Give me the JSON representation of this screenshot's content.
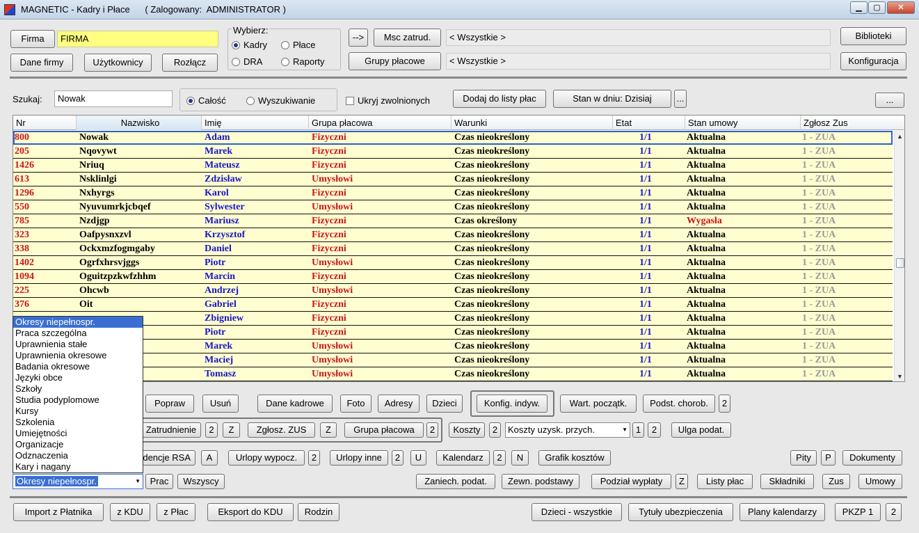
{
  "window": {
    "title": "MAGNETIC - Kadry i Płace      ( Zalogowany:  ADMINISTRATOR )",
    "minimize": "▁",
    "maximize": "▢",
    "close": "✕"
  },
  "top": {
    "firma_button": "Firma",
    "firma_value": "FIRMA",
    "dane_firmy": "Dane firmy",
    "uzytkownicy": "Użytkownicy",
    "rozlacz": "Rozłącz",
    "wybierz_label": "Wybierz:",
    "radio_kadry": "Kadry",
    "radio_place": "Płace",
    "radio_dra": "DRA",
    "radio_raporty": "Raporty",
    "arrow_button": "-->",
    "msc_zatrud": "Msc zatrud.",
    "msc_value": "< Wszystkie >",
    "grupy_placowe": "Grupy płacowe",
    "grupy_value": "< Wszystkie >",
    "biblioteki": "Biblioteki",
    "konfiguracja": "Konfiguracja"
  },
  "search": {
    "label": "Szukaj:",
    "value": "Nowak",
    "radio_calosc": "Całość",
    "radio_wyszukiwanie": "Wyszukiwanie",
    "ukryj": "Ukryj zwolnionych",
    "dodaj": "Dodaj do listy płac",
    "stan_w_dniu": "Stan w dniu: Dzisiaj",
    "dots": "...",
    "dots2": "..."
  },
  "table": {
    "columns": [
      "Nr",
      "Nazwisko",
      "Imię",
      "Grupa płacowa",
      "Warunki",
      "Etat",
      "Stan umowy",
      "Zgłosz Zus"
    ],
    "rows": [
      {
        "nr": "800",
        "nazwisko": "Nowak",
        "imie": "Adam",
        "grupa": "Fizyczni",
        "warunki": "Czas nieokreślony",
        "etat": "1/1",
        "stan": "Aktualna",
        "zus": "1 - ZUA"
      },
      {
        "nr": "205",
        "nazwisko": "Nqovywt",
        "imie": "Marek",
        "grupa": "Fizyczni",
        "warunki": "Czas nieokreślony",
        "etat": "1/1",
        "stan": "Aktualna",
        "zus": "1 - ZUA"
      },
      {
        "nr": "1426",
        "nazwisko": "Nriuq",
        "imie": "Mateusz",
        "grupa": "Fizyczni",
        "warunki": "Czas nieokreślony",
        "etat": "1/1",
        "stan": "Aktualna",
        "zus": "1 - ZUA"
      },
      {
        "nr": "613",
        "nazwisko": "Nsklinlgi",
        "imie": "Zdzisław",
        "grupa": "Umysłowi",
        "warunki": "Czas nieokreślony",
        "etat": "1/1",
        "stan": "Aktualna",
        "zus": "1 - ZUA"
      },
      {
        "nr": "1296",
        "nazwisko": "Nxhyrgs",
        "imie": "Karol",
        "grupa": "Fizyczni",
        "warunki": "Czas nieokreślony",
        "etat": "1/1",
        "stan": "Aktualna",
        "zus": "1 - ZUA"
      },
      {
        "nr": "550",
        "nazwisko": "Nyuvumrkjcbqef",
        "imie": "Sylwester",
        "grupa": "Umysłowi",
        "warunki": "Czas nieokreślony",
        "etat": "1/1",
        "stan": "Aktualna",
        "zus": "1 - ZUA"
      },
      {
        "nr": "785",
        "nazwisko": "Nzdjgp",
        "imie": "Mariusz",
        "grupa": "Fizyczni",
        "warunki": "Czas określony",
        "etat": "1/1",
        "stan": "Wygasła",
        "zus": "1 - ZUA"
      },
      {
        "nr": "323",
        "nazwisko": "Oafpysnxzvl",
        "imie": "Krzysztof",
        "grupa": "Fizyczni",
        "warunki": "Czas nieokreślony",
        "etat": "1/1",
        "stan": "Aktualna",
        "zus": "1 - ZUA"
      },
      {
        "nr": "338",
        "nazwisko": "Ockxmzfogmgaby",
        "imie": "Daniel",
        "grupa": "Fizyczni",
        "warunki": "Czas nieokreślony",
        "etat": "1/1",
        "stan": "Aktualna",
        "zus": "1 - ZUA"
      },
      {
        "nr": "1402",
        "nazwisko": "Ogrfxhrsvjggs",
        "imie": "Piotr",
        "grupa": "Umysłowi",
        "warunki": "Czas nieokreślony",
        "etat": "1/1",
        "stan": "Aktualna",
        "zus": "1 - ZUA"
      },
      {
        "nr": "1094",
        "nazwisko": "Oguitzpzkwfzhhm",
        "imie": "Marcin",
        "grupa": "Fizyczni",
        "warunki": "Czas nieokreślony",
        "etat": "1/1",
        "stan": "Aktualna",
        "zus": "1 - ZUA"
      },
      {
        "nr": "225",
        "nazwisko": "Ohcwb",
        "imie": "Andrzej",
        "grupa": "Umysłowi",
        "warunki": "Czas nieokreślony",
        "etat": "1/1",
        "stan": "Aktualna",
        "zus": "1 - ZUA"
      },
      {
        "nr": "376",
        "nazwisko": "Oit",
        "imie": "Gabriel",
        "grupa": "Fizyczni",
        "warunki": "Czas nieokreślony",
        "etat": "1/1",
        "stan": "Aktualna",
        "zus": "1 - ZUA"
      },
      {
        "nr": "",
        "nazwisko": "",
        "imie": "Zbigniew",
        "grupa": "Fizyczni",
        "warunki": "Czas nieokreślony",
        "etat": "1/1",
        "stan": "Aktualna",
        "zus": "1 - ZUA"
      },
      {
        "nr": "",
        "nazwisko": "",
        "imie": "Piotr",
        "grupa": "Fizyczni",
        "warunki": "Czas nieokreślony",
        "etat": "1/1",
        "stan": "Aktualna",
        "zus": "1 - ZUA"
      },
      {
        "nr": "",
        "nazwisko": "",
        "imie": "Marek",
        "grupa": "Umysłowi",
        "warunki": "Czas nieokreślony",
        "etat": "1/1",
        "stan": "Aktualna",
        "zus": "1 - ZUA"
      },
      {
        "nr": "",
        "nazwisko": "",
        "imie": "Maciej",
        "grupa": "Umysłowi",
        "warunki": "Czas nieokreślony",
        "etat": "1/1",
        "stan": "Aktualna",
        "zus": "1 - ZUA"
      },
      {
        "nr": "",
        "nazwisko": "",
        "imie": "Tomasz",
        "grupa": "Umysłowi",
        "warunki": "Czas nieokreślony",
        "etat": "1/1",
        "stan": "Aktualna",
        "zus": "1 - ZUA"
      }
    ]
  },
  "dropdown": {
    "items": [
      "Okresy niepełnospr.",
      "Praca szczególna",
      "Uprawnienia stałe",
      "Uprawnienia okresowe",
      "Badania okresowe",
      "Języki obce",
      "Szkoły",
      "Studia podyplomowe",
      "Kursy",
      "Szkolenia",
      "Umiejętności",
      "Organizacje",
      "Odznaczenia",
      "Kary i nagany"
    ],
    "selected": "Okresy niepełnospr."
  },
  "buttons": {
    "popraw": "Popraw",
    "usun": "Usuń",
    "dane_kadrowe": "Dane kadrowe",
    "foto": "Foto",
    "adresy": "Adresy",
    "dzieci": "Dzieci",
    "konfig_indyw": "Konfig. indyw.",
    "wart_poczatk": "Wart. początk.",
    "podst_chorob": "Podst. chorob.",
    "n2a": "2",
    "zatrudnienie": "Zatrudnienie",
    "n2b": "2",
    "z1": "Z",
    "zglosz_zus": "Zgłosz. ZUS",
    "z2": "Z",
    "grupa_placowa": "Grupa płacowa",
    "n2c": "2",
    "koszty": "Koszty",
    "n2d": "2",
    "koszty_combo": "Koszty uzysk. przych.",
    "n1": "1",
    "n2e": "2",
    "ulga": "Ulga podat.",
    "ewidencje_rsa": "Ewidencje RSA",
    "a": "A",
    "urlopy_wypocz": "Urlopy wypocz.",
    "n2f": "2",
    "urlopy_inne": "Urlopy inne",
    "n2g": "2",
    "u": "U",
    "kalendarz": "Kalendarz",
    "n2h": "2",
    "n": "N",
    "grafik": "Grafik kosztów",
    "pity": "Pity",
    "p": "P",
    "dokumenty": "Dokumenty",
    "prac": "Prac",
    "wszyscy": "Wszyscy",
    "zaniech": "Zaniech. podat.",
    "zewn": "Zewn. podstawy",
    "podzial": "Podział wypłaty",
    "z3": "Z",
    "listy_plac": "Listy płac",
    "skladniki": "Składniki",
    "zus": "Zus",
    "umowy": "Umowy"
  },
  "bottom": {
    "import": "Import z Płatnika",
    "z_kdu": "z KDU",
    "z_plac": "z Płac",
    "eksport": "Eksport do KDU",
    "rodzin": "Rodzin",
    "dzieci_wszystkie": "Dzieci - wszystkie",
    "tytuly": "Tytuły ubezpieczenia",
    "plany": "Plany kalendarzy",
    "pkzp": "PKZP 1",
    "n2": "2"
  }
}
